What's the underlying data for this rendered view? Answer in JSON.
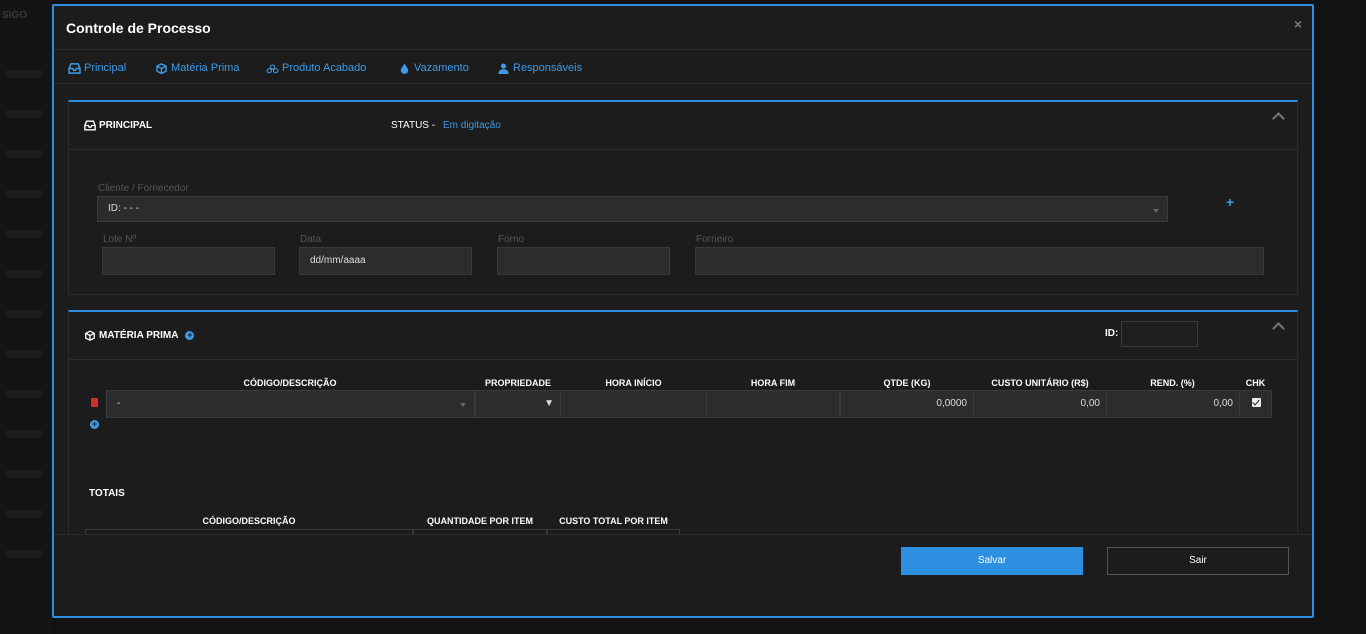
{
  "modal": {
    "title": "Controle de Processo",
    "close_label": "×"
  },
  "background": {
    "logo": "SIGO"
  },
  "tabs": [
    {
      "label": "Principal",
      "icon": "inbox-icon"
    },
    {
      "label": "Matéria Prima",
      "icon": "cube-icon"
    },
    {
      "label": "Produto Acabado",
      "icon": "cubes-icon"
    },
    {
      "label": "Vazamento",
      "icon": "drop-icon"
    },
    {
      "label": "Responsáveis",
      "icon": "user-icon"
    }
  ],
  "principal": {
    "title": "PRINCIPAL",
    "status_label": "STATUS -",
    "status_value": "Em digitação",
    "cliente_label": "Cliente / Fornecedor",
    "cliente_value": "ID: - - -",
    "add_label": "+",
    "lote_label": "Lote Nº",
    "lote_value": "",
    "data_label": "Data",
    "data_value": "dd/mm/aaaa",
    "forno_label": "Forno",
    "forno_value": "",
    "forneiro_label": "Forneiro",
    "forneiro_value": ""
  },
  "materia_prima": {
    "title": "MATÉRIA PRIMA",
    "id_label": "ID:",
    "id_value": "",
    "headers": [
      "CÓDIGO/DESCRIÇÃO",
      "PROPRIEDADE",
      "HORA INÍCIO",
      "HORA FIM",
      "QTDE (KG)",
      "CUSTO UNITÁRIO (R$)",
      "REND. (%)",
      "CHK"
    ],
    "row": {
      "codigo": "-",
      "propriedade_arrow": "▼",
      "hora_inicio": "",
      "hora_fim": "",
      "qtde": "0,0000",
      "custo": "0,00",
      "rend": "0,00",
      "checked": true
    },
    "totais_label": "TOTAIS",
    "totais_headers": [
      "CÓDIGO/DESCRIÇÃO",
      "QUANTIDADE POR ITEM",
      "CUSTO TOTAL POR ITEM"
    ]
  },
  "footer": {
    "save_label": "Salvar",
    "exit_label": "Sair"
  },
  "colors": {
    "accent": "#2e8ee0",
    "link": "#3d9be9",
    "danger": "#d32f2f",
    "background": "#1c1c1c"
  }
}
